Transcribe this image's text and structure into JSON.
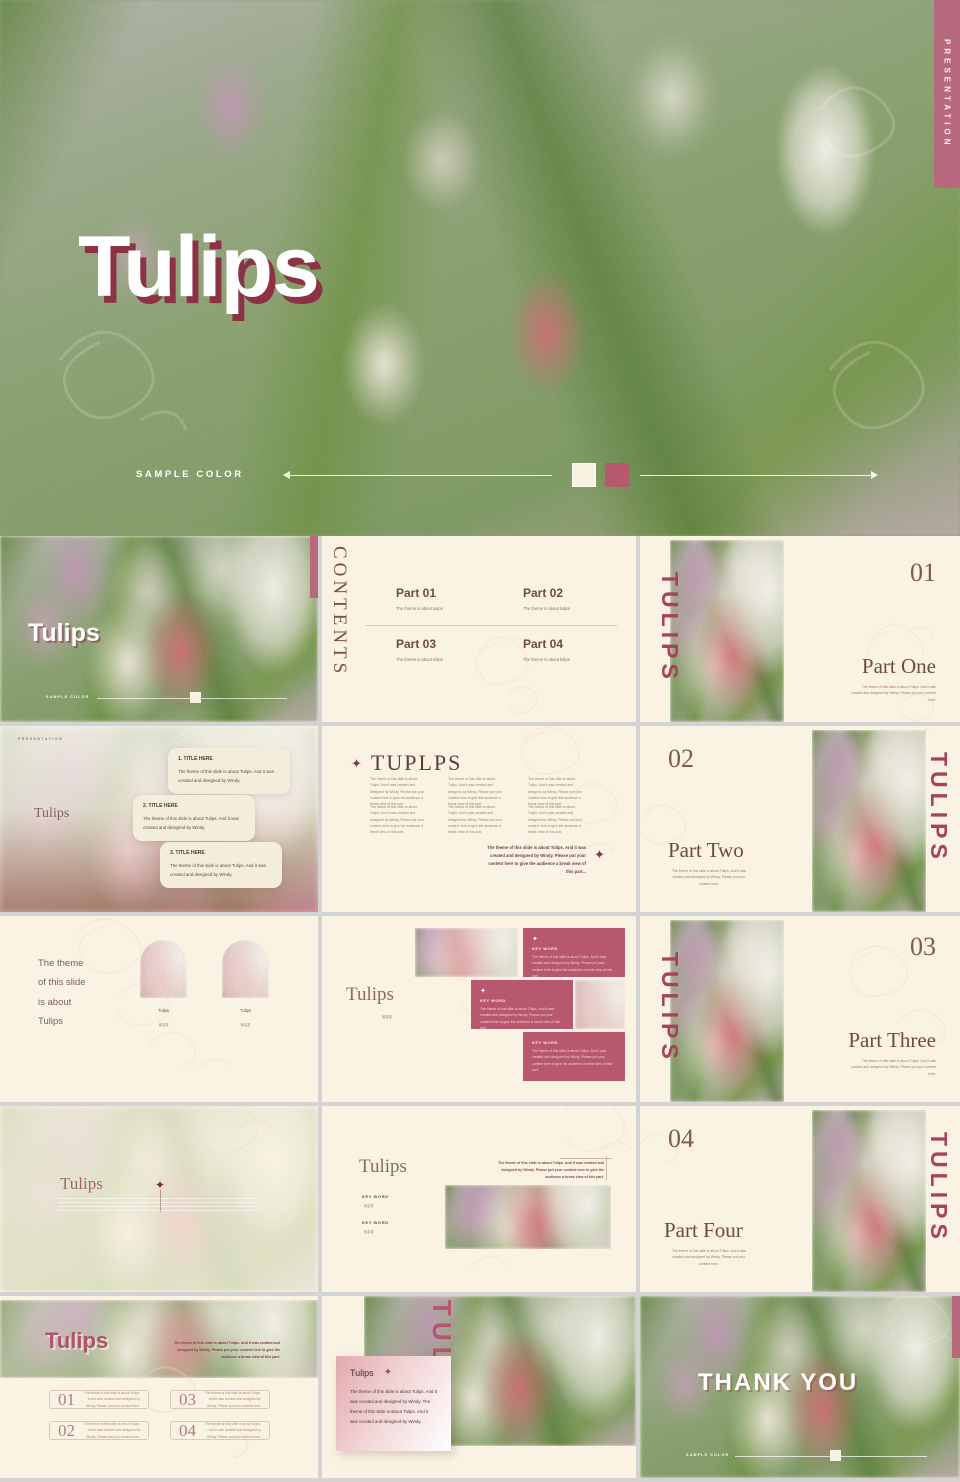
{
  "deck": {
    "title": "Tulips",
    "brand_cream": "#faf3e3",
    "brand_rose": "#b8586e",
    "brand_maroon": "#8c3245",
    "page_bg": "#d3d3d3"
  },
  "hero": {
    "title": "Tulips",
    "sample_color_label": "SAMPLE COLOR",
    "side_tab": "PRESENTATION",
    "swatch_cream": "#f7f1e1",
    "swatch_rose": "#b8586e"
  },
  "slides": {
    "cover_small": {
      "title": "Tulips",
      "sample_color_label": "SAMPLE COLOR",
      "side_tab": "PRESENTATION"
    },
    "contents": {
      "vertical_label": "CONTENTS",
      "items": [
        {
          "title": "Part 01",
          "desc": "The theme is about tulips"
        },
        {
          "title": "Part 02",
          "desc": "The theme is about tulips"
        },
        {
          "title": "Part 03",
          "desc": "The theme is about tulips"
        },
        {
          "title": "Part 04",
          "desc": "The theme is about tulips"
        }
      ]
    },
    "part_one": {
      "number": "01",
      "title": "Part One",
      "desc": "The theme of this slide is about Tulips. And it was created and designed by Windy. Please put your content here.",
      "vertical_label": "TULIPS"
    },
    "part_two": {
      "number": "02",
      "title": "Part Two",
      "desc": "The theme of this slide is about Tulips. And it was created and designed by Windy. Please put your content here.",
      "vertical_label": "TULIPS"
    },
    "part_three": {
      "number": "03",
      "title": "Part Three",
      "desc": "The theme of this slide is about Tulips. And it was created and designed by Windy. Please put your content here.",
      "vertical_label": "TULIPS"
    },
    "part_four": {
      "number": "04",
      "title": "Part Four",
      "desc": "The theme of this slide is about Tulips. And it was created and designed by Windy. Please put your content here.",
      "vertical_label": "TULIPS"
    },
    "cards_slide": {
      "kicker": "PRESENTATION",
      "title": "Tulips",
      "cards": [
        {
          "title": "1. TITLE HERE",
          "body": "The theme of this slide is about Tulips. And it was created and designed by Windy."
        },
        {
          "title": "2. TITLE HERE",
          "body": "The theme of this slide is about Tulips. And it was created and designed by Windy."
        },
        {
          "title": "3. TITLE HERE",
          "body": "The theme of this slide is about Tulips. And it was created and designed by Windy."
        }
      ]
    },
    "tuplps": {
      "title": "TUPLPS",
      "columns": [
        "The theme of this slide is about Tulips. And it was created and designed by Windy. Please put your content here to give the audience a break view of this part.",
        "The theme of this slide is about Tulips. And it was created and designed by Windy. Please put your content here to give the audience a break view of this part.",
        "The theme of this slide is about Tulips. And it was created and designed by Windy. Please put your content here to give the audience a break view of this part.",
        "The theme of this slide is about Tulips. And it was created and designed by Windy. Please put your content here to give the audience a break view of this part.",
        "The theme of this slide is about Tulips. And it was created and designed by Windy. Please put your content here to give the audience a break view of this part.",
        "The theme of this slide is about Tulips. And it was created and designed by Windy. Please put your content here to give the audience a break view of this part."
      ],
      "footnote": "The theme of this slide is about Tulips. And it was created and designed by Windy. Please put your content here to give the audience a break view of this part..."
    },
    "arches": {
      "headline": "The theme\nof this slide\nis about\nTulips",
      "items": [
        {
          "caption": "Tulips",
          "subcaption": "郁金香"
        },
        {
          "caption": "Tulips",
          "subcaption": "郁金香"
        }
      ]
    },
    "keywords_grid": {
      "title": "Tulips",
      "subtitle": "郁金香",
      "boxes": [
        {
          "keyword": "KEY WORD",
          "body": "The theme of this slide is about Tulips. And it was created and designed by Windy. Please put your content here to give the audience a break view of this part."
        },
        {
          "keyword": "KEY WORD",
          "body": "The theme of this slide is about Tulips. And it was created and designed by Windy. Please put your content here to give the audience a break view of this part."
        },
        {
          "keyword": "KEY WORD",
          "body": "The theme of this slide is about Tulips. And it was created and designed by Windy. Please put your content here to give the audience a break view of this part."
        }
      ]
    },
    "quote_slide": {
      "title": "Tulips"
    },
    "keywords_photo": {
      "title": "Tulips",
      "desc": "The theme of this slide is about Tulips. And it was created and designed by Windy. Please put your content here to give the audience a break view of this part.",
      "keywords": [
        {
          "label": "KEY WORD",
          "sub": "郁金香"
        },
        {
          "label": "KEY WORD",
          "sub": "郁金香"
        }
      ]
    },
    "numbers_slide": {
      "title": "Tulips",
      "desc": "The theme of this slide is about Tulips. And it was created and designed by Windy. Please put your content here to give the audience a break view of this part.",
      "items": [
        {
          "number": "01",
          "body": "The theme of this slide is about Tulips. And it was created and designed by Windy. Please put your content here."
        },
        {
          "number": "02",
          "body": "The theme of this slide is about Tulips. And it was created and designed by Windy. Please put your content here."
        },
        {
          "number": "03",
          "body": "The theme of this slide is about Tulips. And it was created and designed by Windy. Please put your content here."
        },
        {
          "number": "04",
          "body": "The theme of this slide is about Tulips. And it was created and designed by Windy. Please put your content here."
        }
      ]
    },
    "panel_slide": {
      "title": "Tulips",
      "body": "The theme of this slide is about Tulips. And it was created and designed by Windy. The theme of this slide is about Tulips. And it was created and designed by Windy.",
      "vertical_label": "TULIPS"
    },
    "thank_you": {
      "title": "THANK YOU",
      "sample_color_label": "SAMPLE COLOR",
      "side_tab": "PRESENTATION"
    }
  }
}
